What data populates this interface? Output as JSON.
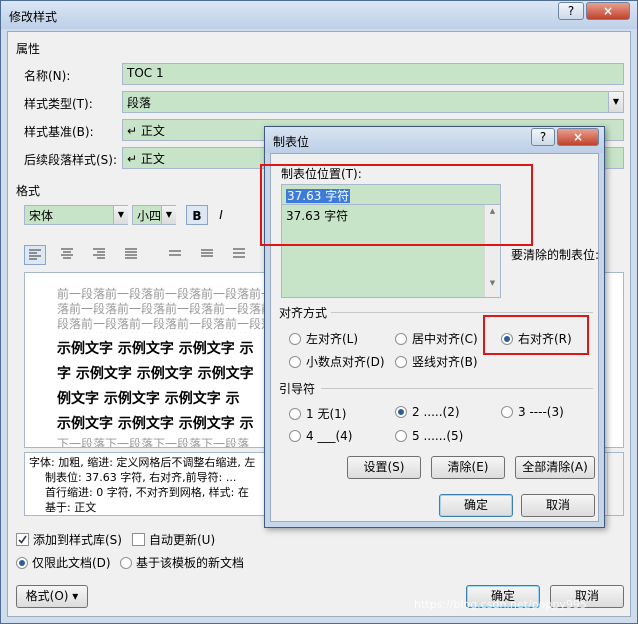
{
  "main_dialog": {
    "title": "修改样式",
    "help_button": "?",
    "close_button": "×",
    "properties_group": "属性",
    "name_label": "名称(N):",
    "name_value": "TOC 1",
    "style_type_label": "样式类型(T):",
    "style_type_value": "段落",
    "style_based_label": "样式基准(B):",
    "style_based_value": "↵ 正文",
    "next_style_label": "后续段落样式(S):",
    "next_style_value": "↵ 正文",
    "format_group": "格式",
    "font_value": "宋体",
    "size_value": "小四",
    "bold_label": "B",
    "italic_label": "I",
    "preview_prev": "前一段落前一段落前一段落前一段落前一段落前一段落前一段落前一段落前一段落前一段落前一段落前一段落前一段落前一段落前一段落前一段落前一段落前一段落前一段落前一段落前一段落",
    "sample_lines": [
      "示例文字 示例文字 示例文字 示",
      "字 示例文字 示例文字 示例文字",
      "例文字 示例文字 示例文字 示",
      "示例文字 示例文字 示例文字 示"
    ],
    "preview_next": "下一段落下一段落下一段落下一段落",
    "description_lines": [
      "字体: 加粗, 缩进: 定义网格后不调整右缩进, 左",
      "制表位: 37.63 字符, 右对齐,前导符: ...",
      "首行缩进: 0 字符, 不对齐到网格, 样式: 在",
      "基于: 正文"
    ],
    "add_to_gallery": "添加到样式库(S)",
    "auto_update": "自动更新(U)",
    "only_this_doc": "仅限此文档(D)",
    "new_docs_template": "基于该模板的新文档",
    "format_button": "格式(O) ▾",
    "ok_button": "确定",
    "cancel_button": "取消"
  },
  "tab_dialog": {
    "title": "制表位",
    "help_button": "?",
    "close_button": "×",
    "position_label": "制表位位置(T):",
    "position_value": "37.63 字符",
    "position_list": [
      "37.63 字符"
    ],
    "to_clear_label": "要清除的制表位:",
    "alignment_group": "对齐方式",
    "alignment_options": [
      {
        "label": "左对齐(L)",
        "selected": false
      },
      {
        "label": "居中对齐(C)",
        "selected": false
      },
      {
        "label": "右对齐(R)",
        "selected": true
      },
      {
        "label": "小数点对齐(D)",
        "selected": false
      },
      {
        "label": "竖线对齐(B)",
        "selected": false
      }
    ],
    "leader_group": "引导符",
    "leader_options": [
      {
        "label": "1 无(1)",
        "selected": false
      },
      {
        "label": "2 .....(2)",
        "selected": true
      },
      {
        "label": "3 ----(3)",
        "selected": false
      },
      {
        "label": "4 ___(4)",
        "selected": false
      },
      {
        "label": "5 ......(5)",
        "selected": false
      }
    ],
    "set_button": "设置(S)",
    "clear_button": "清除(E)",
    "clear_all_button": "全部清除(A)",
    "ok_button": "确定",
    "cancel_button": "取消"
  },
  "watermark": "https://blog.csdn.net/poppy995",
  "colors": {
    "field_green": "#c8e4c8",
    "highlight_red": "#e01515",
    "dialog_frame": "#cfdcec"
  }
}
